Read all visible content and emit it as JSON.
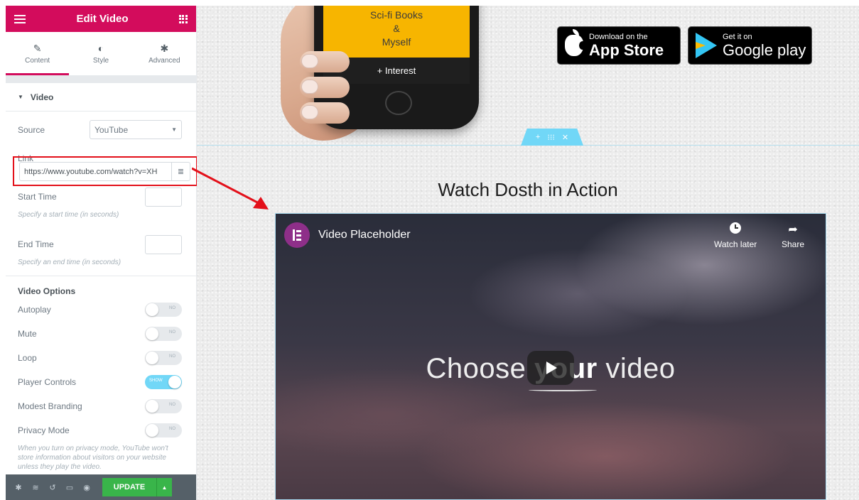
{
  "sidebar": {
    "title": "Edit Video",
    "tabs": [
      {
        "label": "Content",
        "icon": "pencil-icon"
      },
      {
        "label": "Style",
        "icon": "half-circle-icon"
      },
      {
        "label": "Advanced",
        "icon": "gear-icon"
      }
    ],
    "section_title": "Video",
    "source_label": "Source",
    "source_value": "YouTube",
    "link_label": "Link",
    "link_value": "https://www.youtube.com/watch?v=XH",
    "start_time_label": "Start Time",
    "start_time_hint": "Specify a start time (in seconds)",
    "end_time_label": "End Time",
    "end_time_hint": "Specify an end time (in seconds)",
    "video_options_label": "Video Options",
    "toggles": [
      {
        "label": "Autoplay",
        "state": "NO"
      },
      {
        "label": "Mute",
        "state": "NO"
      },
      {
        "label": "Loop",
        "state": "NO"
      },
      {
        "label": "Player Controls",
        "state": "SHOW"
      },
      {
        "label": "Modest Branding",
        "state": "NO"
      },
      {
        "label": "Privacy Mode",
        "state": "NO"
      }
    ],
    "privacy_hint": "When you turn on privacy mode, YouTube won't store information about visitors on your website unless they play the video.",
    "update_label": "UPDATE",
    "accent_color": "#d30c5c",
    "update_color": "#39b54a"
  },
  "preview": {
    "phone_lines": [
      "Sci-fi Books",
      "&",
      "Myself"
    ],
    "phone_interest": "+ Interest",
    "app_store_small": "Download on the",
    "app_store_big": "App Store",
    "google_small": "Get it on",
    "google_big": "Google play",
    "headline": "Watch Dosth in Action",
    "video_title": "Video Placeholder",
    "watch_later": "Watch later",
    "share": "Share",
    "center_text_a": "Choose ",
    "center_text_b": "your",
    "center_text_c": " video"
  }
}
